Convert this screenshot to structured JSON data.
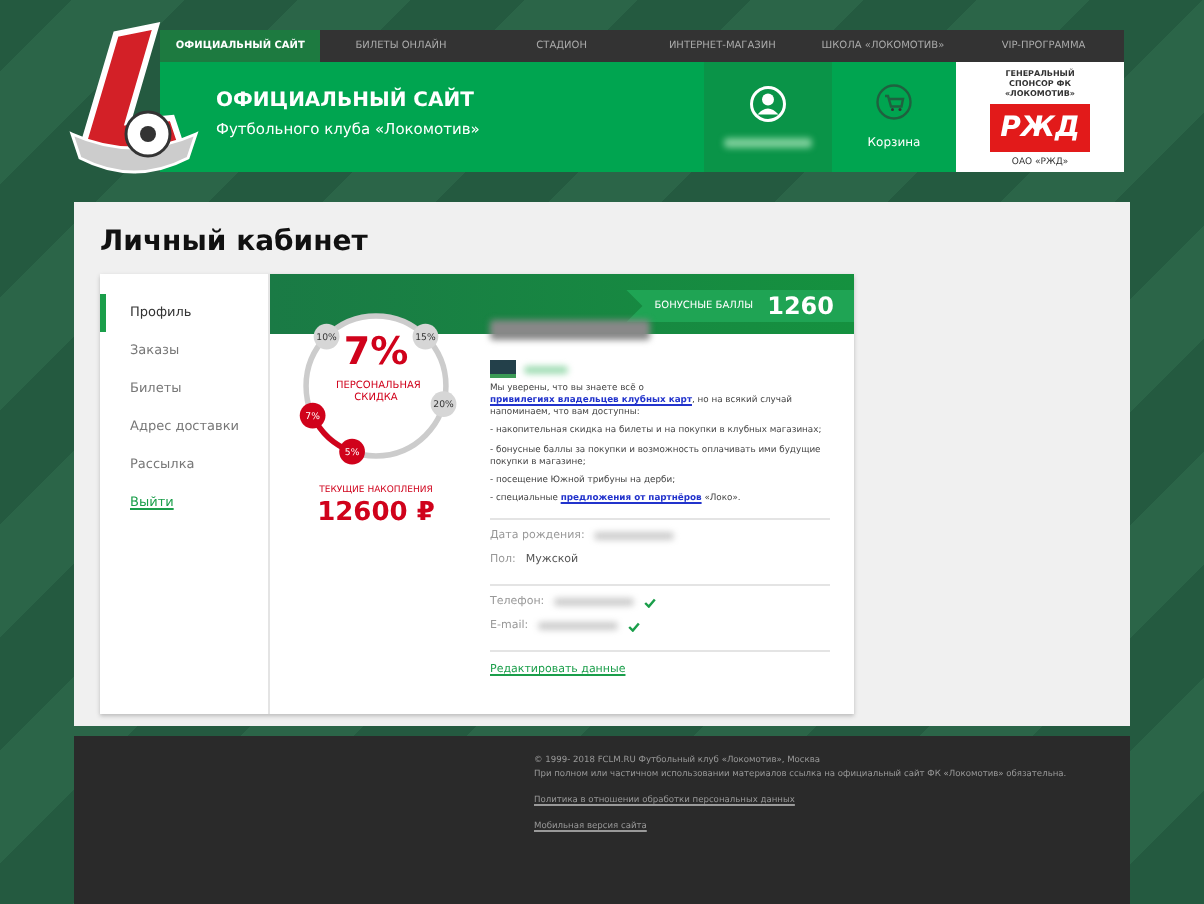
{
  "nav": [
    {
      "label": "ОФИЦИАЛЬНЫЙ САЙТ",
      "selected": true
    },
    {
      "label": "БИЛЕТЫ ОНЛАЙН",
      "selected": false
    },
    {
      "label": "СТАДИОН",
      "selected": false
    },
    {
      "label": "ИНТЕРНЕТ-МАГАЗИН",
      "selected": false
    },
    {
      "label": "ШКОЛА «ЛОКОМОТИВ»",
      "selected": false
    },
    {
      "label": "VIP-ПРОГРАММА",
      "selected": false
    }
  ],
  "header": {
    "title": "ОФИЦИАЛЬНЫЙ САЙТ",
    "subtitle": "Футбольного клуба «Локомотив»",
    "cart": "Корзина",
    "sponsor_caption": "ГЕНЕРАЛЬНЫЙ СПОНСОР ФК «ЛОКОМОТИВ»",
    "sponsor_logo": "РЖД",
    "sponsor_name": "ОАО «РЖД»"
  },
  "page_title": "Личный кабинет",
  "sidebar": {
    "items": [
      {
        "label": "Профиль",
        "kind": "item",
        "selected": true
      },
      {
        "label": "Заказы",
        "kind": "item",
        "selected": false
      },
      {
        "label": "Билеты",
        "kind": "item",
        "selected": false
      },
      {
        "label": "Адрес доставки",
        "kind": "item",
        "selected": false
      },
      {
        "label": "Рассылка",
        "kind": "item",
        "selected": false
      },
      {
        "label": "Выйти",
        "kind": "link",
        "selected": false
      }
    ]
  },
  "discount": {
    "value": "7%",
    "label": "ПЕРСОНАЛЬНАЯ СКИДКА",
    "levels": [
      {
        "label": "5%",
        "reached": true
      },
      {
        "label": "7%",
        "reached": true
      },
      {
        "label": "10%",
        "reached": false
      },
      {
        "label": "15%",
        "reached": false
      },
      {
        "label": "20%",
        "reached": false
      }
    ],
    "savings_label": "ТЕКУЩИЕ НАКОПЛЕНИЯ",
    "savings": "12600 ₽"
  },
  "bonus": {
    "label": "БОНУСНЫЕ БАЛЛЫ",
    "value": "1260"
  },
  "intro": {
    "before": "Мы уверены, что вы знаете всё о ",
    "link": "привилегиях владельцев клубных карт",
    "after": ", но на всякий случай напоминаем, что вам доступны:"
  },
  "benefits": [
    {
      "before": "- накопительная скидка на билеты и на покупки в клубных магазинах;"
    },
    {
      "before": "- бонусные баллы за покупки и возможность оплачивать ими будущие покупки в магазине;"
    },
    {
      "before": "- посещение Южной трибуны на дерби;"
    },
    {
      "before": "- специальные ",
      "link": "предложения от партнёров",
      "after": " «Локо»."
    }
  ],
  "field_groups": [
    [
      {
        "label": "Дата рождения:"
      },
      {
        "label": "Пол:",
        "value": "Мужской"
      }
    ],
    [
      {
        "label": "Телефон:",
        "verified": true
      },
      {
        "label": "E-mail:",
        "verified": true
      }
    ]
  ],
  "edit_link": "Редактировать данные",
  "footer": {
    "copyright": "© 1999- 2018 FCLM.RU Футбольный клуб «Локомотив», Москва",
    "notice": "При полном или частичном использовании материалов ссылка на официальный сайт ФК «Локомотив» обязательна.",
    "links": [
      "Политика в отношении обработки персональных данных",
      "Мобильная версия сайта"
    ]
  }
}
